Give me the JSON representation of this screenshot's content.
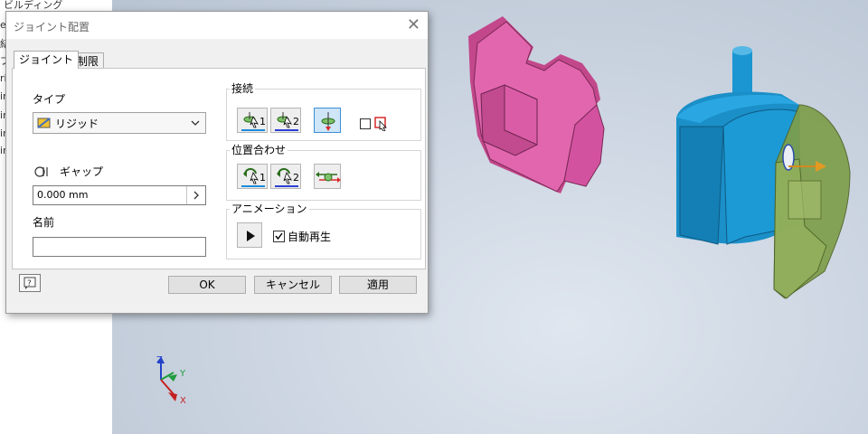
{
  "dialog": {
    "title": "ジョイント配置",
    "close_glyph": "✕",
    "tabs": [
      "ジョイント",
      "制限"
    ],
    "type_label": "タイプ",
    "type_value": "リジッド",
    "gap_label": "ギャップ",
    "gap_value": "0.000 mm",
    "name_label": "名前",
    "name_value": "",
    "connect_group": "接続",
    "align_group": "位置合わせ",
    "anim_group": "アニメーション",
    "btn_sub_1": "1",
    "btn_sub_2": "2",
    "autoplay_label": "自動再生",
    "autoplay_checked": true,
    "ok_label": "OK",
    "cancel_label": "キャンセル",
    "apply_label": "適用"
  },
  "browser_fragments": [
    "ビルディング",
    "e",
    "結",
    "プ",
    "ri",
    "in",
    "in",
    "in",
    "in"
  ],
  "axis_labels": {
    "z": "Z",
    "y": "Y",
    "x": "X"
  },
  "colors": {
    "pink_part": "#e060a8",
    "blue_part": "#1a9ad6",
    "green_part": "#8fae5a",
    "accent": "#3c8fd6"
  }
}
